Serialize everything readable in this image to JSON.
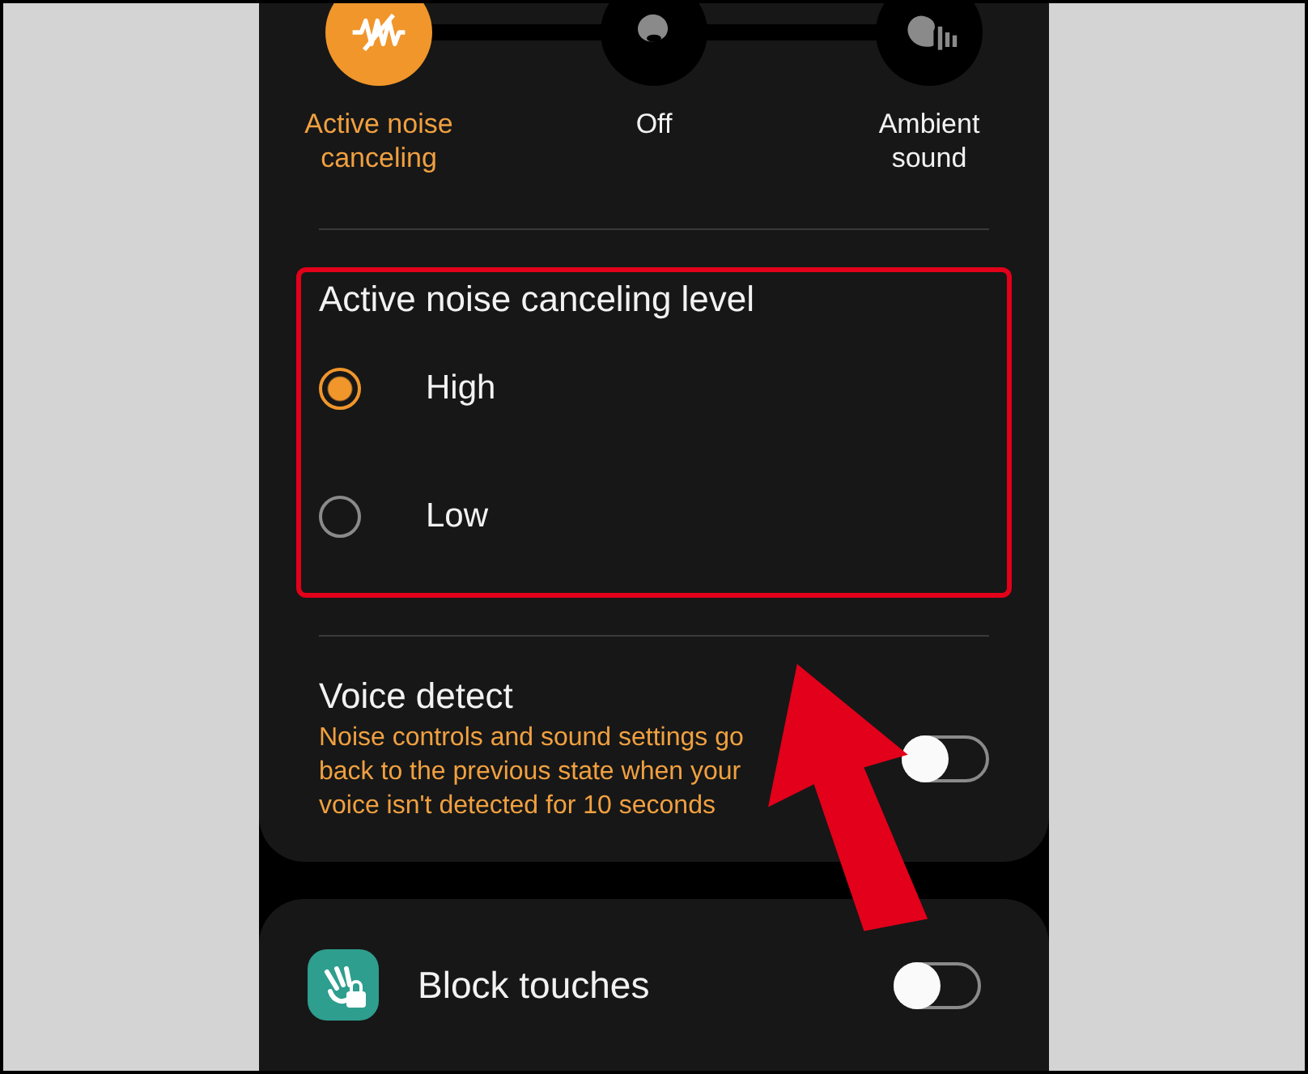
{
  "modes": [
    {
      "kind": "anc",
      "label": "Active noise canceling",
      "selected": true
    },
    {
      "kind": "off",
      "label": "Off",
      "selected": false
    },
    {
      "kind": "ambient",
      "label": "Ambient sound",
      "selected": false
    }
  ],
  "anc_level": {
    "title": "Active noise canceling level",
    "options": [
      {
        "label": "High",
        "selected": true
      },
      {
        "label": "Low",
        "selected": false
      }
    ]
  },
  "voice_detect": {
    "title": "Voice detect",
    "description": "Noise controls and sound settings go back to the previous state when your voice isn't detected for 10 seconds",
    "on": false
  },
  "block_touches": {
    "title": "Block touches",
    "on": false
  }
}
